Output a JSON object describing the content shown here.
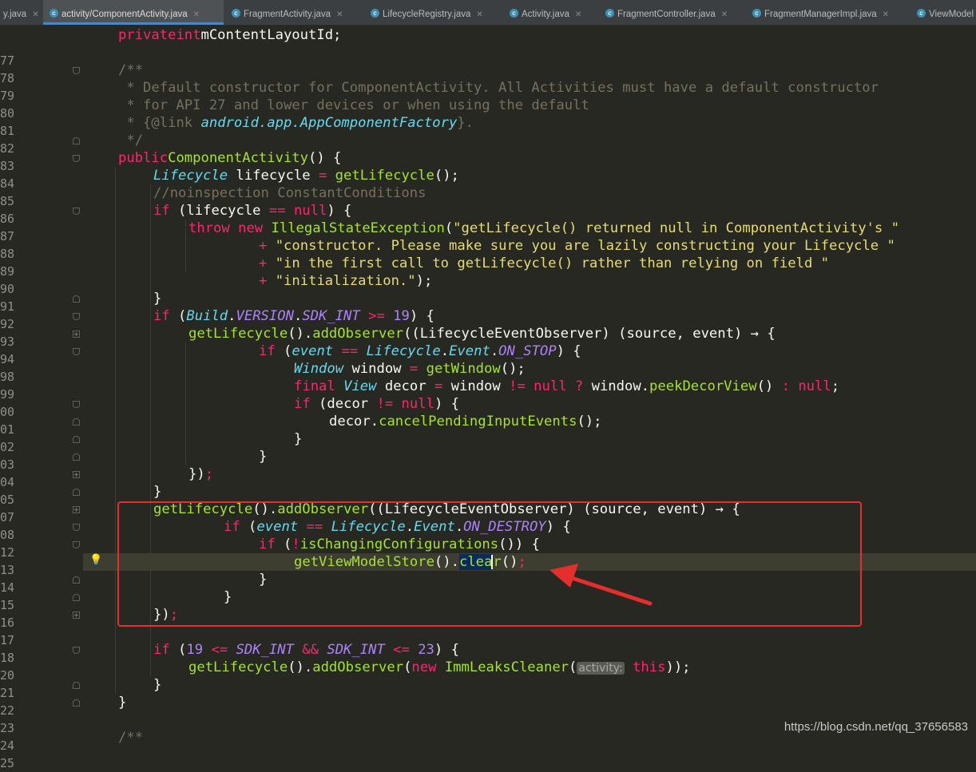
{
  "tabs": [
    {
      "label": "y.java",
      "icon": "none",
      "active": false
    },
    {
      "label": "activity/ComponentActivity.java",
      "icon": "class-icon",
      "active": true
    },
    {
      "label": "FragmentActivity.java",
      "icon": "class-icon",
      "active": false
    },
    {
      "label": "LifecycleRegistry.java",
      "icon": "class-icon",
      "active": false
    },
    {
      "label": "Activity.java",
      "icon": "class-icon",
      "active": false
    },
    {
      "label": "FragmentController.java",
      "icon": "class-icon",
      "active": false
    },
    {
      "label": "FragmentManagerImpl.java",
      "icon": "class-icon",
      "active": false
    },
    {
      "label": "ViewModel",
      "icon": "class-icon",
      "active": false
    }
  ],
  "line_numbers": [
    "77",
    "78",
    "79",
    "80",
    "81",
    "82",
    "83",
    "84",
    "85",
    "86",
    "87",
    "88",
    "89",
    "90",
    "91",
    "92",
    "93",
    "94",
    "98",
    "99",
    "00",
    "01",
    "02",
    "03",
    "04",
    "05",
    "07",
    "08",
    "12",
    "13",
    "14",
    "15",
    "16",
    "17",
    "18",
    "20",
    "21",
    "22",
    "23",
    "24",
    "25"
  ],
  "current_line": "14",
  "code": {
    "l77": [
      "private",
      "int",
      "mContentLayoutId;"
    ],
    "l79": "/**",
    "l80": " * Default constructor for ComponentActivity. All Activities must have a default constructor",
    "l81": " * for API 27 and lower devices or when using the default",
    "l82": [
      " * {",
      "@link",
      " ",
      "android.app.AppComponentFactory",
      "}."
    ],
    "l83": " */",
    "l84": [
      "public",
      "ComponentActivity",
      "() {"
    ],
    "l85": [
      "Lifecycle",
      " lifecycle ",
      "=",
      " getLifecycle",
      "();"
    ],
    "l86": "//noinspection ConstantConditions",
    "l87": [
      "if",
      " (lifecycle ",
      "==",
      " null",
      ") {"
    ],
    "l88": [
      "throw",
      " new ",
      "IllegalStateException",
      "(",
      "\"getLifecycle() returned null in ComponentActivity's \""
    ],
    "l89": [
      "+",
      " \"constructor. Please make sure you are lazily constructing your Lifecycle \""
    ],
    "l90": [
      "+",
      " \"in the first call to getLifecycle() rather than relying on field \""
    ],
    "l91": [
      "+",
      " \"initialization.\"",
      ");"
    ],
    "l92": "}",
    "l93": [
      "if",
      " (",
      "Build",
      ".",
      "VERSION",
      ".",
      "SDK_INT",
      " >= ",
      "19",
      ") {"
    ],
    "l94": [
      "getLifecycle",
      "().",
      "addObserver",
      "((LifecycleEventObserver) (source, event) → {"
    ],
    "l98": [
      "if",
      " (",
      "event",
      " == ",
      "Lifecycle",
      ".",
      "Event",
      ".",
      "ON_STOP",
      ") {"
    ],
    "l99": [
      "Window",
      " window ",
      "=",
      " getWindow",
      "();"
    ],
    "l00": [
      "final",
      " View",
      " decor ",
      "=",
      " window ",
      "!=",
      " null",
      " ?",
      " window.",
      "peekDecorView",
      "() ",
      ":",
      " null",
      ";"
    ],
    "l01": [
      "if",
      " (decor ",
      "!=",
      " null",
      ") {"
    ],
    "l02": [
      "decor.",
      "cancelPendingInputEvents",
      "();"
    ],
    "l03": "}",
    "l04": "}",
    "l05": [
      "})",
      ";"
    ],
    "l07": "}",
    "l08": [
      "getLifecycle",
      "().",
      "addObserver",
      "((LifecycleEventObserver) (source, event) → {"
    ],
    "l12": [
      "if",
      " (",
      "event",
      " == ",
      "Lifecycle",
      ".",
      "Event",
      ".",
      "ON_DESTROY",
      ") {"
    ],
    "l13": [
      "if",
      " (",
      "!",
      "isChangingConfigurations",
      "()) {"
    ],
    "l14": [
      "getViewModelStore",
      "().",
      "clea",
      "r",
      "()",
      ";"
    ],
    "l15": "}",
    "l16": "}",
    "l17": [
      "})",
      ";"
    ],
    "l20": [
      "if",
      " (",
      "19",
      " <= ",
      "SDK_INT",
      " && ",
      "SDK_INT",
      " <= ",
      "23",
      ") {"
    ],
    "l21": [
      "getLifecycle",
      "().",
      "addObserver",
      "(",
      "new",
      " ImmLeaksCleaner",
      "(",
      "activity:",
      "this",
      "));"
    ],
    "l22": "}",
    "l23": "}",
    "l25": "/**"
  },
  "watermark": "https://blog.csdn.net/qq_37656583",
  "colors": {
    "background": "#272822",
    "keyword": "#f92672",
    "function": "#a6e22e",
    "type": "#66d9ef",
    "string": "#e6db74",
    "number": "#ae81ff",
    "comment": "#75715e",
    "annotation_box": "#e52e2e"
  }
}
